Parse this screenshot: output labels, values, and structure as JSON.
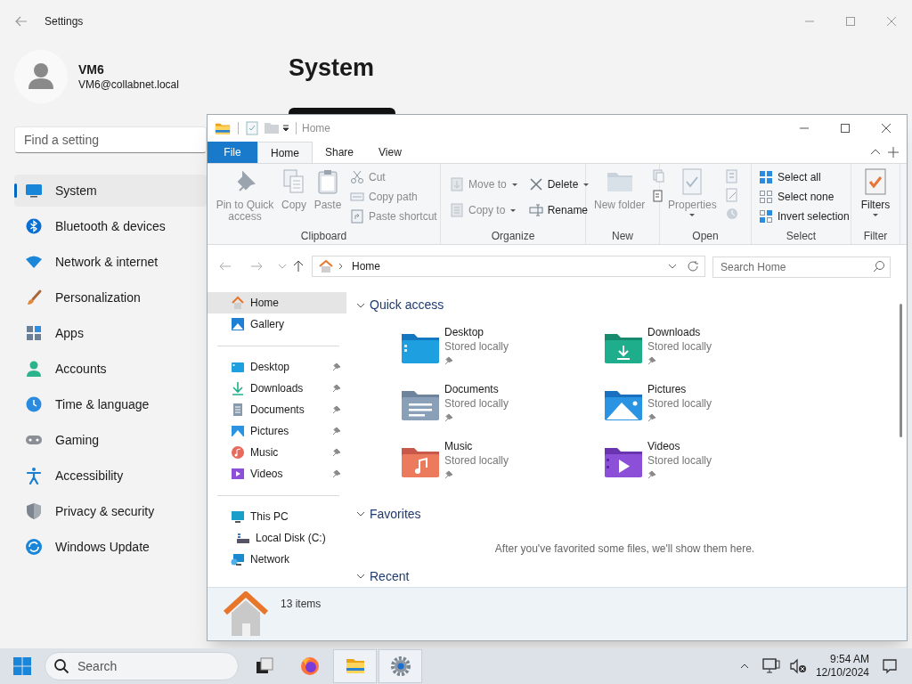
{
  "settings": {
    "title": "Settings",
    "user": {
      "name": "VM6",
      "email": "VM6@collabnet.local"
    },
    "search": {
      "placeholder": "Find a setting"
    },
    "page_title": "System",
    "nav": [
      {
        "label": "System",
        "kind": "system",
        "selected": true
      },
      {
        "label": "Bluetooth & devices",
        "kind": "bluetooth",
        "selected": false
      },
      {
        "label": "Network & internet",
        "kind": "network",
        "selected": false
      },
      {
        "label": "Personalization",
        "kind": "personalization",
        "selected": false
      },
      {
        "label": "Apps",
        "kind": "apps",
        "selected": false
      },
      {
        "label": "Accounts",
        "kind": "accounts",
        "selected": false
      },
      {
        "label": "Time & language",
        "kind": "time",
        "selected": false
      },
      {
        "label": "Gaming",
        "kind": "gaming",
        "selected": false
      },
      {
        "label": "Accessibility",
        "kind": "accessibility",
        "selected": false
      },
      {
        "label": "Privacy & security",
        "kind": "privacy",
        "selected": false
      },
      {
        "label": "Windows Update",
        "kind": "update",
        "selected": false
      }
    ]
  },
  "explorer": {
    "title": "Home",
    "ribbon_tabs": [
      {
        "label": "File",
        "kind": "file",
        "selected": false
      },
      {
        "label": "Home",
        "kind": "tab",
        "selected": true
      },
      {
        "label": "Share",
        "kind": "tab",
        "selected": false
      },
      {
        "label": "View",
        "kind": "tab",
        "selected": false
      }
    ],
    "ribbon_groups": [
      {
        "label": "Clipboard",
        "kind": "clipboard",
        "items": [
          {
            "label": "Pin to Quick access",
            "disabled": true
          },
          {
            "label": "Copy",
            "disabled": true
          },
          {
            "label": "Paste",
            "disabled": true
          },
          {
            "label": "Cut",
            "disabled": true
          },
          {
            "label": "Copy path",
            "disabled": true
          },
          {
            "label": "Paste shortcut",
            "disabled": true
          }
        ]
      },
      {
        "label": "Organize",
        "kind": "organize",
        "items": [
          {
            "label": "Move to",
            "disabled": true,
            "dropdown": true
          },
          {
            "label": "Copy to",
            "disabled": true,
            "dropdown": true
          },
          {
            "label": "Delete",
            "disabled": false,
            "dropdown": true
          },
          {
            "label": "Rename",
            "disabled": false,
            "dropdown": false
          }
        ]
      },
      {
        "label": "New",
        "kind": "new",
        "items": [
          {
            "label": "New folder",
            "disabled": true
          }
        ]
      },
      {
        "label": "Open",
        "kind": "open",
        "items": [
          {
            "label": "Properties",
            "disabled": true,
            "dropdown": true
          }
        ]
      },
      {
        "label": "Select",
        "kind": "select",
        "items": [
          {
            "label": "Select all",
            "disabled": false
          },
          {
            "label": "Select none",
            "disabled": false
          },
          {
            "label": "Invert selection",
            "disabled": false
          }
        ]
      },
      {
        "label": "Filter",
        "kind": "filter",
        "items": [
          {
            "label": "Filters",
            "disabled": false,
            "dropdown": true
          }
        ]
      }
    ],
    "address": "Home",
    "search": {
      "placeholder": "Search Home"
    },
    "nav_pane": [
      [
        {
          "label": "Home",
          "kind": "home",
          "selected": true
        },
        {
          "label": "Gallery",
          "kind": "gallery",
          "selected": false
        }
      ],
      [
        {
          "label": "Desktop",
          "kind": "desktop",
          "selected": false,
          "pinned": true
        },
        {
          "label": "Downloads",
          "kind": "downloads",
          "selected": false,
          "pinned": true
        },
        {
          "label": "Documents",
          "kind": "documents",
          "selected": false,
          "pinned": true
        },
        {
          "label": "Pictures",
          "kind": "pictures",
          "selected": false,
          "pinned": true
        },
        {
          "label": "Music",
          "kind": "music",
          "selected": false,
          "pinned": true
        },
        {
          "label": "Videos",
          "kind": "videos",
          "selected": false,
          "pinned": true
        }
      ],
      [
        {
          "label": "This PC",
          "kind": "pc",
          "selected": false,
          "children": [
            {
              "label": "Local Disk (C:)",
              "kind": "disk",
              "selected": false
            }
          ]
        },
        {
          "label": "Network",
          "kind": "network",
          "selected": false
        }
      ]
    ],
    "sections": [
      {
        "title": "Quick access",
        "expanded": true,
        "items": [
          {
            "name": "Desktop",
            "status": "Stored locally",
            "kind": "desktop",
            "pinned": true
          },
          {
            "name": "Downloads",
            "status": "Stored locally",
            "kind": "downloads",
            "pinned": true
          },
          {
            "name": "Documents",
            "status": "Stored locally",
            "kind": "documents",
            "pinned": true
          },
          {
            "name": "Pictures",
            "status": "Stored locally",
            "kind": "pictures",
            "pinned": true
          },
          {
            "name": "Music",
            "status": "Stored locally",
            "kind": "music",
            "pinned": true
          },
          {
            "name": "Videos",
            "status": "Stored locally",
            "kind": "videos",
            "pinned": true
          }
        ]
      },
      {
        "title": "Favorites",
        "expanded": true,
        "message": "After you've favorited some files, we'll show them here."
      },
      {
        "title": "Recent",
        "expanded": true
      }
    ],
    "status": "13 items"
  },
  "taskbar": {
    "search": {
      "placeholder": "Search"
    },
    "apps": [
      {
        "kind": "taskview",
        "active": false
      },
      {
        "kind": "firefox",
        "active": false
      },
      {
        "kind": "explorer",
        "active": true
      },
      {
        "kind": "settings",
        "active": true
      }
    ],
    "time": "9:54 AM",
    "date": "12/10/2024"
  }
}
